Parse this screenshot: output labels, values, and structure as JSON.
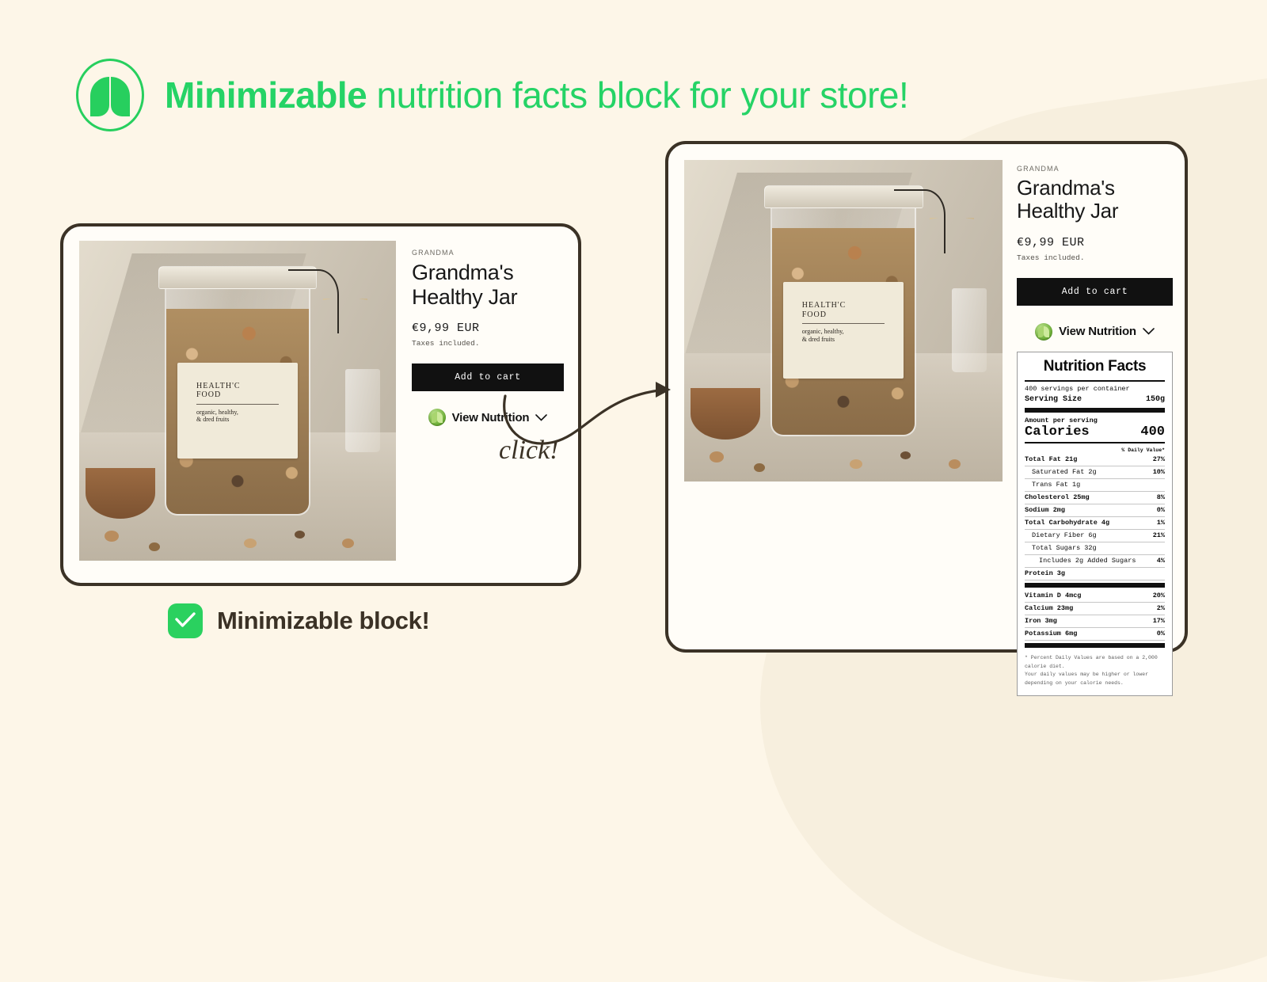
{
  "headline": {
    "strong": "Minimizable",
    "rest": " nutrition facts block for your store!",
    "accent_color": "#25d366",
    "logo_icon": "leaf-circle-logo"
  },
  "background": {
    "page_color": "#fdf6e8",
    "swoosh_color": "#f7efde",
    "card_border_color": "#3b3226",
    "card_fill_color": "#fffdf8"
  },
  "annotation": {
    "click_label": "click!",
    "arrow_icon": "curved-arrow-icon"
  },
  "caption": {
    "check_icon": "check-mark-icon",
    "text": "Minimizable block!",
    "badge_color": "#2ad15f",
    "text_color": "#3b3226"
  },
  "product": {
    "vendor": "GRANDMA",
    "title": "Grandma's Healthy Jar",
    "price": "€9,99 EUR",
    "taxes": "Taxes included.",
    "add_to_cart": "Add to cart",
    "view_nutrition": "View Nutrition",
    "leaf_icon": "leaf-badge-icon",
    "chevron_icon": "chevron-down-icon",
    "photo": {
      "alt": "glass jar filled with nuts and dried fruits on a table",
      "label_line1": "HEALTH'C",
      "label_line2": "FOOD",
      "label_line3": "organic, healthy,",
      "label_line4": "& dred fruits"
    }
  },
  "nutrition": {
    "title": "Nutrition Facts",
    "servings_per_container": "400 servings per container",
    "serving_size_label": "Serving Size",
    "serving_size_value": "150g",
    "amount_per_serving": "Amount per serving",
    "calories_label": "Calories",
    "calories_value": "400",
    "daily_value_header": "% Daily Value*",
    "rows": [
      {
        "label": "Total Fat 21g",
        "value": "27%",
        "bold": true,
        "indent": 0
      },
      {
        "label": "Saturated Fat 2g",
        "value": "10%",
        "bold": false,
        "indent": 1
      },
      {
        "label": "Trans Fat 1g",
        "value": "",
        "bold": false,
        "indent": 1
      },
      {
        "label": "Cholesterol 25mg",
        "value": "8%",
        "bold": true,
        "indent": 0
      },
      {
        "label": "Sodium 2mg",
        "value": "0%",
        "bold": true,
        "indent": 0
      },
      {
        "label": "Total Carbohydrate 4g",
        "value": "1%",
        "bold": true,
        "indent": 0
      },
      {
        "label": "Dietary Fiber 6g",
        "value": "21%",
        "bold": false,
        "indent": 1
      },
      {
        "label": "Total Sugars 32g",
        "value": "",
        "bold": false,
        "indent": 1
      },
      {
        "label": "Includes 2g Added Sugars",
        "value": "4%",
        "bold": false,
        "indent": 2
      },
      {
        "label": "Protein 3g",
        "value": "",
        "bold": true,
        "indent": 0
      }
    ],
    "micro_rows": [
      {
        "label": "Vitamin D 4mcg",
        "value": "20%"
      },
      {
        "label": "Calcium 23mg",
        "value": "2%"
      },
      {
        "label": "Iron 3mg",
        "value": "17%"
      },
      {
        "label": "Potassium 6mg",
        "value": "0%"
      }
    ],
    "footnote_1": "* Percent Daily Values are based on a 2,000",
    "footnote_2": "calorie diet.",
    "footnote_3": "Your daily values may be higher or lower",
    "footnote_4": "depending on your calorie needs."
  }
}
